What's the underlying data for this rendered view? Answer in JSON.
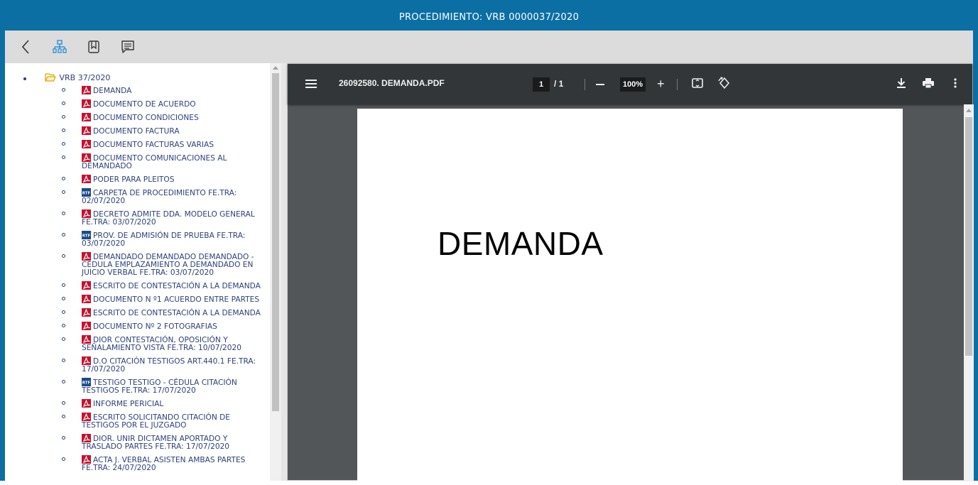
{
  "header": {
    "title": "PROCEDIMIENTO: VRB 0000037/2020"
  },
  "toolbar": {
    "buttons": [
      {
        "icon": "back-icon"
      },
      {
        "icon": "sitemap-icon"
      },
      {
        "icon": "bookmark-icon"
      },
      {
        "icon": "comment-icon"
      }
    ]
  },
  "tree": {
    "root_label": "VRB 37/2020",
    "items": [
      {
        "type": "pdf",
        "label": "DEMANDA"
      },
      {
        "type": "pdf",
        "label": "DOCUMENTO DE ACUERDO"
      },
      {
        "type": "pdf",
        "label": "DOCUMENTO CONDICIONES"
      },
      {
        "type": "pdf",
        "label": "DOCUMENTO FACTURA"
      },
      {
        "type": "pdf",
        "label": "DOCUMENTO FACTURAS VARIAS"
      },
      {
        "type": "pdf",
        "label": "DOCUMENTO COMUNICACIONES AL DEMANDADO"
      },
      {
        "type": "pdf",
        "label": "PODER PARA PLEITOS"
      },
      {
        "type": "rtf",
        "label": "CARPETA DE PROCEDIMIENTO FE.TRA: 02/07/2020"
      },
      {
        "type": "pdf",
        "label": "DECRETO ADMITE DDA. MODELO GENERAL FE.TRA: 03/07/2020"
      },
      {
        "type": "rtf",
        "label": "PROV. DE ADMISIÓN DE PRUEBA FE.TRA: 03/07/2020"
      },
      {
        "type": "pdf",
        "label": "DEMANDADO DEMANDADO DEMANDADO - CÉDULA EMPLAZAMIENTO A DEMANDADO EN JUICIO VERBAL FE.TRA: 03/07/2020"
      },
      {
        "type": "pdf",
        "label": "ESCRITO DE CONTESTACIÓN A LA DEMANDA"
      },
      {
        "type": "pdf",
        "label": "DOCUMENTO N º1 ACUERDO ENTRE PARTES"
      },
      {
        "type": "pdf",
        "label": "ESCRITO DE CONTESTACIÓN A LA DEMANDA"
      },
      {
        "type": "pdf",
        "label": "DOCUMENTO Nº 2 FOTOGRAFIAS"
      },
      {
        "type": "pdf",
        "label": "DIOR CONTESTACIÓN, OPOSICIÓN Y SEÑALAMIENTO VISTA FE.TRA: 10/07/2020"
      },
      {
        "type": "pdf",
        "label": "D.O CITACIÓN TESTIGOS ART.440.1 FE.TRA: 17/07/2020"
      },
      {
        "type": "rtf",
        "label": "TESTIGO TESTIGO - CÉDULA CITACIÓN TESTIGOS FE.TRA: 17/07/2020"
      },
      {
        "type": "pdf",
        "label": "INFORME PERICIAL"
      },
      {
        "type": "pdf",
        "label": "ESCRITO SOLICITANDO CITACIÓN DE TESTIGOS POR EL JUZGADO"
      },
      {
        "type": "pdf",
        "label": "DIOR. UNIR DICTAMEN APORTADO Y TRASLADO PARTES FE.TRA: 17/07/2020"
      },
      {
        "type": "pdf",
        "label": "ACTA J. VERBAL ASISTEN AMBAS PARTES FE.TRA: 24/07/2020"
      }
    ]
  },
  "viewer": {
    "file_name": "26092580. DEMANDA.PDF",
    "page_current": "1",
    "page_total": "/ 1",
    "zoom": "100%",
    "page_text": "DEMANDA"
  },
  "colors": {
    "brand": "#0b6fa4",
    "pdf_red": "#c8102e",
    "rtf_blue": "#1b4a8a",
    "viewer_bar": "#323639"
  }
}
